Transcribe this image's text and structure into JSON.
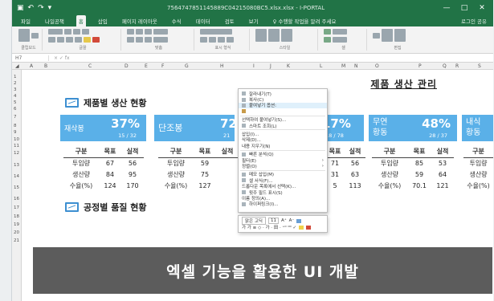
{
  "window": {
    "title": "7564747851145889C04215080BC5.xlsx.xlsx - I-PORTAL",
    "controls": [
      "—",
      "□",
      "✕"
    ]
  },
  "ribbon_tabs": [
    "파일",
    "나일공책",
    "홈",
    "삽입",
    "페이지 레이아웃",
    "수식",
    "데이터",
    "검토",
    "보기",
    "♀ 수행할 작업을 알려 주세요"
  ],
  "ribbon_tabs_right": "로그인  공유",
  "ribbon_groups": [
    "클립보드",
    "글꼴",
    "맞춤",
    "표시 형식",
    "스타일",
    "셀",
    "편집"
  ],
  "name_box": "H7",
  "sheet_title": "제품 생산 관리",
  "col_headers": [
    "A",
    "B",
    "C",
    "D",
    "E",
    "F",
    "G",
    "H",
    "I",
    "J",
    "K",
    "L",
    "M",
    "N",
    "O",
    "P",
    "Q",
    "R",
    "S"
  ],
  "row_headers": [
    "1",
    "2",
    "3",
    "4",
    "5",
    "6",
    "7",
    "8",
    "9",
    "10",
    "11",
    "12",
    "13",
    "14",
    "15",
    "16",
    "17",
    "18",
    "19",
    "20",
    "21"
  ],
  "section1": {
    "title": "제품별 생산 현황"
  },
  "section2": {
    "title": "공정별 품질 현황"
  },
  "cards": [
    {
      "name": "재삭봉",
      "percent": "37%",
      "count": "15 / 32"
    },
    {
      "name": "단조봉",
      "percent": "72",
      "count": "21"
    },
    {
      "name": "",
      "percent": "17%",
      "count": "18 / 78"
    },
    {
      "name": "무연\n황동",
      "percent": "48%",
      "count": "28 / 37"
    },
    {
      "name": "내식\n황동",
      "percent": "",
      "count": ""
    }
  ],
  "tables": [
    {
      "header": [
        "구분",
        "목표",
        "실적"
      ],
      "rows": [
        [
          "투입량",
          "67",
          "56"
        ],
        [
          "생산량",
          "84",
          "95"
        ],
        [
          "수율(%)",
          "124",
          "170"
        ]
      ]
    },
    {
      "header": [
        "구분",
        "목표",
        "실적"
      ],
      "rows": [
        [
          "투입량",
          "59",
          ""
        ],
        [
          "생산량",
          "75",
          ""
        ],
        [
          "수율(%)",
          "127",
          ""
        ]
      ]
    },
    {
      "header": [
        "",
        "목표",
        "실적"
      ],
      "rows": [
        [
          "",
          "71",
          "56"
        ],
        [
          "",
          "31",
          "63"
        ],
        [
          "",
          "5",
          "113"
        ]
      ]
    },
    {
      "header": [
        "구분",
        "목표",
        "실적"
      ],
      "rows": [
        [
          "투입량",
          "85",
          "53"
        ],
        [
          "생산량",
          "59",
          "64"
        ],
        [
          "수율(%)",
          "70.1",
          "121"
        ]
      ]
    },
    {
      "header": [
        "구분"
      ],
      "rows": [
        [
          "투입량"
        ],
        [
          "생산량"
        ],
        [
          "수율(%)"
        ]
      ]
    }
  ],
  "context_menu": {
    "items": [
      {
        "label": "잘라내기(T)",
        "highlight": false
      },
      {
        "label": "복사(C)",
        "highlight": false
      },
      {
        "label": "붙여넣기 옵션:",
        "highlight": true
      },
      {
        "label": "",
        "highlight": false
      },
      {
        "label": "선택하여 붙여넣기(S)...",
        "highlight": false
      },
      {
        "label": "스마트 조회(L)",
        "highlight": false
      },
      {
        "label": "삽입(I)...",
        "highlight": false
      },
      {
        "label": "삭제(D)...",
        "highlight": false
      },
      {
        "label": "내용 지우기(N)",
        "highlight": false
      },
      {
        "label": "빠른 분석(Q)",
        "highlight": false
      },
      {
        "label": "필터(E)",
        "highlight": false
      },
      {
        "label": "정렬(O)",
        "highlight": false
      },
      {
        "label": "메모 삽입(M)",
        "highlight": false
      },
      {
        "label": "셀 서식(F)...",
        "highlight": false
      },
      {
        "label": "드롭다운 목록에서 선택(K)...",
        "highlight": false
      },
      {
        "label": "윗주 필드 표시(S)",
        "highlight": false
      },
      {
        "label": "이름 정의(A)...",
        "highlight": false
      },
      {
        "label": "하이퍼링크(I)...",
        "highlight": false
      }
    ]
  },
  "mini_toolbar": {
    "font": "맑은 고딕",
    "size": "11",
    "row2": "가  가  ≡  ◇ · 가 · 田 · ⁺⁰ ⁰⁰ ✓"
  },
  "banner_text": "엑셀 기능을 활용한 UI 개발",
  "colors": {
    "excel_green": "#217346",
    "card_blue": "#5ab0e8",
    "icon_blue": "#3d8fd1",
    "banner": "#464646"
  }
}
